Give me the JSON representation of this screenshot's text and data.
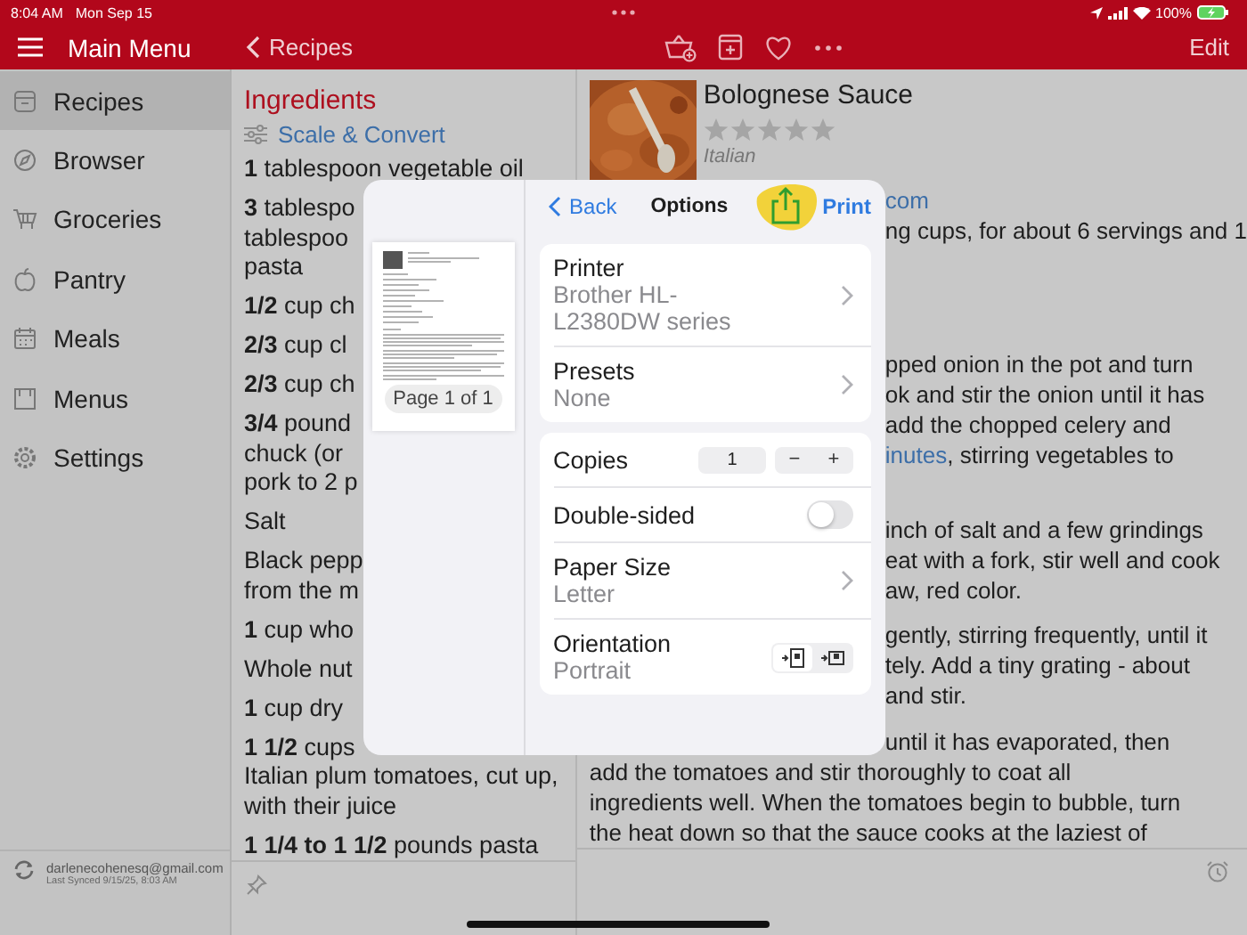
{
  "status_bar": {
    "time": "8:04 AM",
    "date": "Mon Sep 15",
    "battery": "100%"
  },
  "toolbar": {
    "title": "Main Menu",
    "back": "Recipes",
    "edit": "Edit"
  },
  "sidebar": {
    "items": [
      {
        "label": "Recipes",
        "selected": true
      },
      {
        "label": "Browser",
        "selected": false
      },
      {
        "label": "Groceries",
        "selected": false
      },
      {
        "label": "Pantry",
        "selected": false
      },
      {
        "label": "Meals",
        "selected": false
      },
      {
        "label": "Menus",
        "selected": false
      },
      {
        "label": "Settings",
        "selected": false
      }
    ],
    "account": "darlenecohenesq@gmail.com",
    "last_synced": "Last Synced 9/15/25, 8:03 AM"
  },
  "ingredients": {
    "title": "Ingredients",
    "scale_link": "Scale & Convert",
    "items": [
      {
        "lines": [
          "**1** tablespoon vegetable oil"
        ]
      },
      {
        "lines": [
          "**3** tablespo",
          "tablespoo",
          "pasta"
        ]
      },
      {
        "lines": [
          "**1/2** cup ch"
        ]
      },
      {
        "lines": [
          "**2/3** cup cl"
        ]
      },
      {
        "lines": [
          "**2/3** cup ch"
        ]
      },
      {
        "lines": [
          "**3/4** pound",
          "chuck (or",
          "pork to 2 p"
        ]
      },
      {
        "lines": [
          "Salt"
        ]
      },
      {
        "lines": [
          "Black pepp",
          "from the m"
        ]
      },
      {
        "lines": [
          "**1** cup who"
        ]
      },
      {
        "lines": [
          "Whole nut"
        ]
      },
      {
        "lines": [
          "**1** cup dry"
        ]
      },
      {
        "lines": [
          "**1 1/2** cups",
          "Italian plum tomatoes, cut up,",
          "with their juice"
        ]
      },
      {
        "lines": [
          "**1 1/4 to 1 1/2** pounds pasta"
        ]
      }
    ]
  },
  "recipe": {
    "title": "Bolognese Sauce",
    "stars": 0,
    "category": "Italian",
    "paragraphs": [
      {
        "lines": [
          {
            "kind": "fragment",
            "link": "com"
          },
          {
            "kind": "fragment",
            "text": "ng cups, for about 6 servings and 1"
          }
        ]
      },
      {
        "lines": [
          {
            "kind": "fragment",
            "text": "pped onion in the pot and turn"
          },
          {
            "kind": "fragment",
            "text": "ok and stir the onion until it has"
          },
          {
            "kind": "fragment",
            "text": "add the chopped celery and"
          },
          {
            "kind": "fragment",
            "link": "inutes",
            "text": ", stirring vegetables to"
          }
        ]
      },
      {
        "lines": [
          {
            "kind": "fragment",
            "text": "inch of salt and a few grindings"
          },
          {
            "kind": "fragment",
            "text": "eat with a fork, stir well and cook"
          },
          {
            "kind": "fragment",
            "text": "aw, red color."
          }
        ]
      },
      {
        "lines": [
          {
            "kind": "fragment",
            "text": "gently, stirring frequently, until it"
          },
          {
            "kind": "fragment",
            "text": "tely. Add a tiny grating - about"
          },
          {
            "kind": "fragment",
            "text": "and stir."
          }
        ]
      },
      {
        "lines": [
          {
            "kind": "fragment",
            "text": "until it has evaporated, then"
          },
          {
            "kind": "full",
            "text": "add the tomatoes and stir thoroughly to coat all"
          },
          {
            "kind": "full",
            "text": "ingredients well. When the tomatoes begin to bubble, turn"
          },
          {
            "kind": "full",
            "text": "the heat down so that the sauce cooks at the laziest of"
          }
        ]
      }
    ]
  },
  "print_dialog": {
    "back": "Back",
    "title": "Options",
    "print": "Print",
    "page_label": "Page 1 of 1",
    "groups": [
      [
        {
          "kind": "nav",
          "label": "Printer",
          "value": "Brother HL-L2380DW series"
        },
        {
          "kind": "nav",
          "label": "Presets",
          "value": "None"
        }
      ],
      [
        {
          "kind": "stepper",
          "label": "Copies",
          "value": "1",
          "minus": "−",
          "plus": "+"
        },
        {
          "kind": "toggle",
          "label": "Double-sided",
          "on": false
        },
        {
          "kind": "nav",
          "label": "Paper Size",
          "value": "Letter"
        },
        {
          "kind": "orientation",
          "label": "Orientation",
          "value": "Portrait",
          "options": [
            {
              "selected": true
            },
            {
              "selected": false
            }
          ]
        }
      ]
    ]
  }
}
